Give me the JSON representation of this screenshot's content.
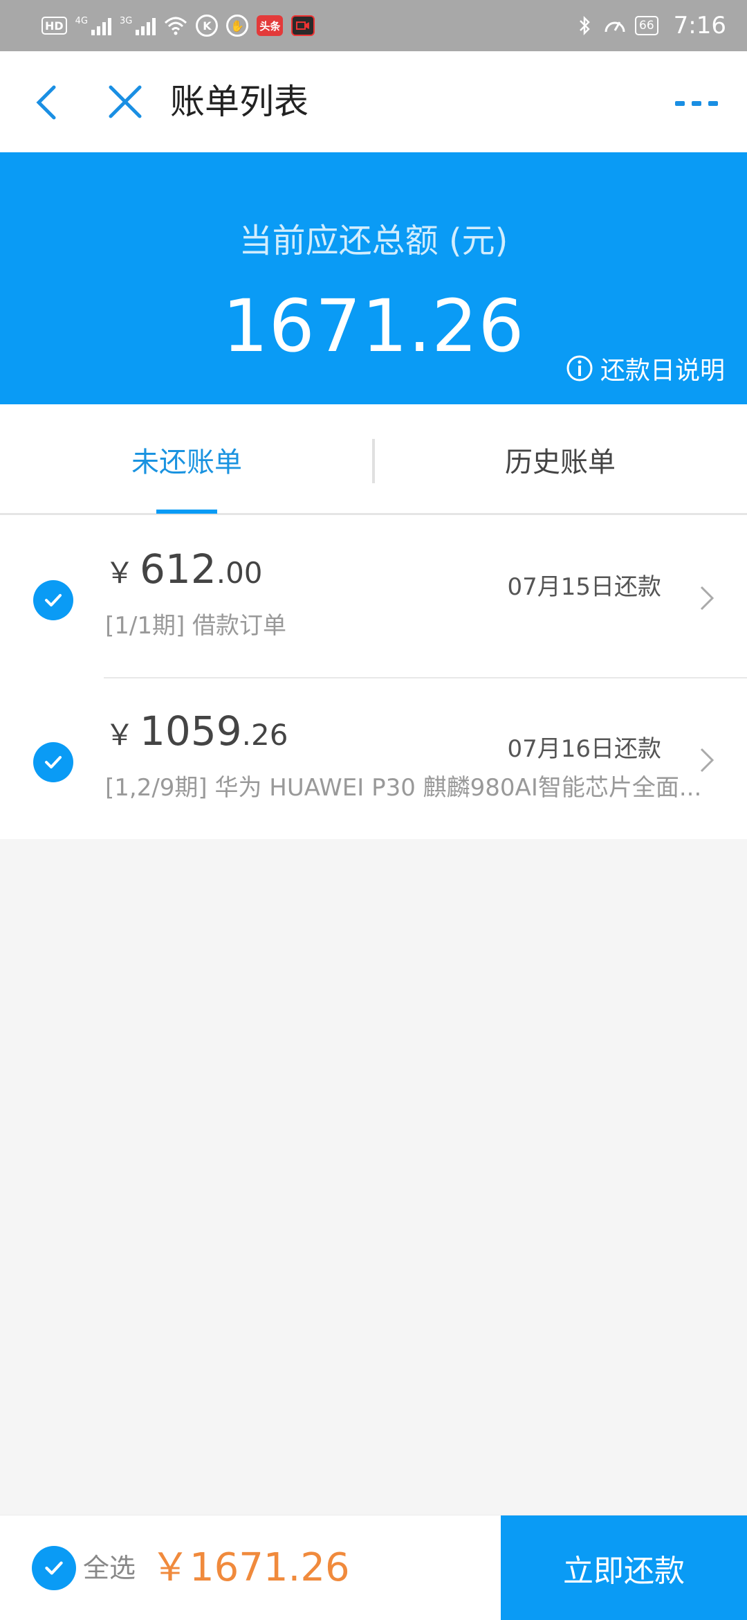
{
  "status_bar": {
    "hd": "HD",
    "signal1_tag": "4G",
    "signal2_tag": "3G",
    "k_icon": "K",
    "toutiao": "头条",
    "battery": "66",
    "time": "7:16"
  },
  "header": {
    "title": "账单列表"
  },
  "summary": {
    "label": "当前应还总额 (元)",
    "amount": "1671.26",
    "repay_info": "还款日说明"
  },
  "tabs": [
    {
      "label": "未还账单",
      "active": true
    },
    {
      "label": "历史账单",
      "active": false
    }
  ],
  "bills": [
    {
      "currency": "￥",
      "amount_int": "612",
      "amount_dec": ".00",
      "due": "07月15日还款",
      "desc": "[1/1期] 借款订单",
      "checked": true
    },
    {
      "currency": "￥",
      "amount_int": "1059",
      "amount_dec": ".26",
      "due": "07月16日还款",
      "desc": "[1,2/9期] 华为 HUAWEI P30 麒麟980AI智能芯片全面...",
      "checked": true
    }
  ],
  "footer": {
    "select_all": "全选",
    "total": "￥1671.26",
    "pay_button": "立即还款"
  },
  "colors": {
    "accent": "#0a9bf5",
    "total": "#f08a3c"
  }
}
